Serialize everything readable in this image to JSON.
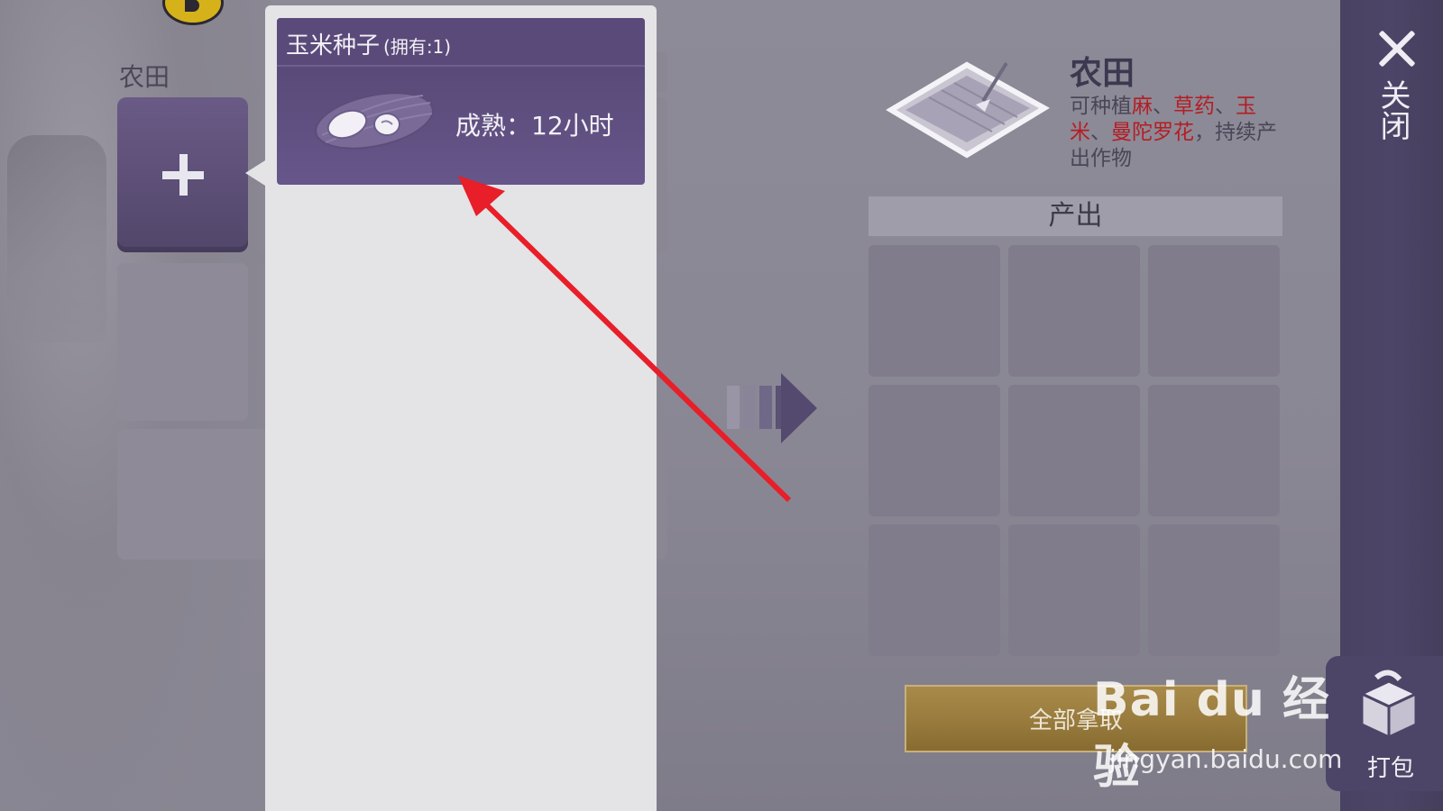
{
  "header": {
    "farm_label": "农田"
  },
  "seed_card": {
    "name": "玉米种子",
    "owned": "(拥有:1)",
    "mature": "成熟：12小时"
  },
  "info": {
    "title": "农田",
    "desc_prefix": "可种植",
    "crop1": "麻",
    "sep1": "、",
    "crop2": "草药",
    "sep2": "、",
    "crop3": "玉米",
    "sep3": "、",
    "crop4": "曼陀罗花",
    "desc_suffix": "，持续产出作物"
  },
  "output": {
    "header": "产出",
    "cells": 9
  },
  "buttons": {
    "collect_all": "全部拿取",
    "close": "关闭",
    "pack": "打包"
  },
  "watermark": {
    "brand": "Bai du 经验",
    "url": "jingyan.baidu.com"
  },
  "colors": {
    "highlight": "#b51d24",
    "seed_card": "#5c4c7c",
    "sidebar": "#4a4262",
    "collect_button": "#9a7c3e",
    "annotation_arrow": "#e81e28"
  },
  "icons": [
    "corn-seed-icon",
    "farm-field-icon",
    "plus-icon",
    "flow-arrow-icon",
    "close-icon",
    "pack-box-icon"
  ]
}
